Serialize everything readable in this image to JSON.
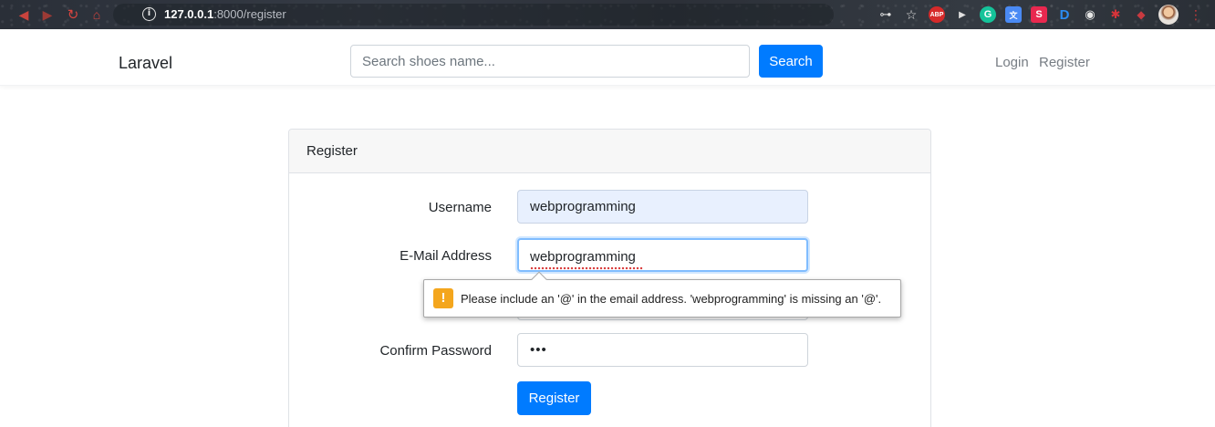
{
  "browser": {
    "url_host": "127.0.0.1",
    "url_path": ":8000/register",
    "icons": {
      "back": "back-arrow-icon",
      "forward": "forward-arrow-icon",
      "reload": "reload-icon",
      "home": "home-icon",
      "site_info": "info-icon",
      "extensions": [
        "key-icon",
        "star-icon",
        "adblock-icon",
        "play-icon",
        "grammarly-icon",
        "translate-icon",
        "s-extension-icon",
        "d-extension-icon",
        "globe-icon",
        "puzzle-icon",
        "red-extension-icon",
        "avatar",
        "menu-icon"
      ]
    },
    "abp_label": "ABP",
    "g_label": "G",
    "s_label": "S",
    "d_label": "D"
  },
  "navbar": {
    "brand": "Laravel",
    "search_placeholder": "Search shoes name...",
    "search_button": "Search",
    "login": "Login",
    "register": "Register"
  },
  "card": {
    "header": "Register",
    "labels": {
      "username": "Username",
      "email": "E-Mail Address",
      "confirm_password": "Confirm Password"
    },
    "values": {
      "username": "webprogramming",
      "email": "webprogramming",
      "confirm_password": "•••"
    },
    "submit": "Register"
  },
  "tooltip": {
    "icon": "!",
    "message": "Please include an '@' in the email address. 'webprogramming' is missing an '@'."
  },
  "colors": {
    "primary": "#007bff",
    "warning": "#f4a61d",
    "autofill": "#e8f0fe",
    "focus_border": "#80bdff"
  }
}
